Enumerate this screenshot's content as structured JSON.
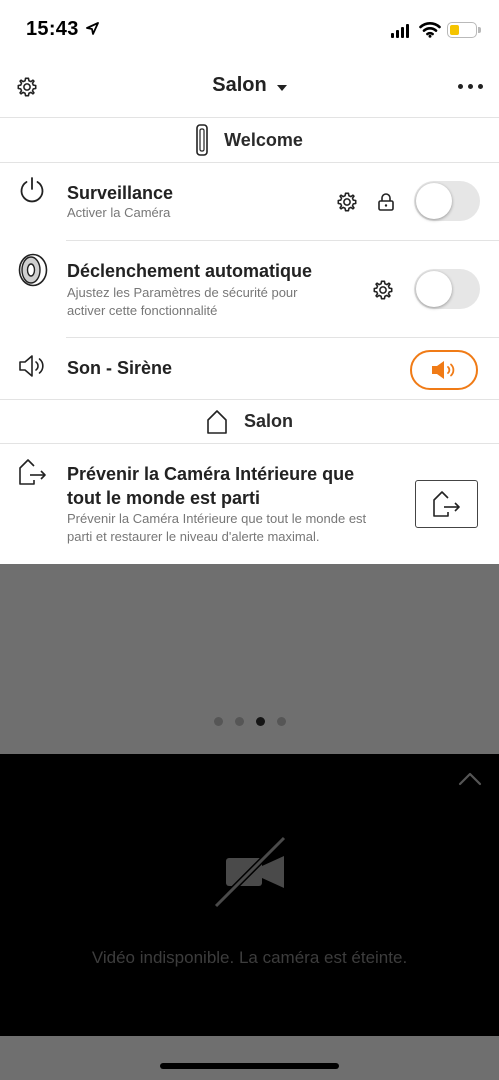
{
  "status_bar": {
    "time": "15:43"
  },
  "header": {
    "title": "Salon",
    "icons": [
      "gear-icon",
      "chevron-down-icon",
      "more-icon"
    ]
  },
  "camera_section": {
    "label": "Welcome",
    "icon": "camera-icon"
  },
  "surveillance": {
    "title": "Surveillance",
    "subtitle": "Activer la Caméra",
    "enabled": false,
    "icons": [
      "power-icon",
      "gear-icon",
      "lock-icon"
    ]
  },
  "auto_trigger": {
    "title": "Déclenchement automatique",
    "subtitle_line1": "Ajustez les Paramètres de sécurité pour",
    "subtitle_line2": "activer cette fonctionnalité",
    "enabled": false,
    "icons": [
      "siren-device-icon",
      "gear-icon"
    ]
  },
  "siren": {
    "title": "Son - Sirène",
    "icons": [
      "speaker-icon",
      "speaker-on-icon"
    ],
    "accent": "#f07b16"
  },
  "home_section": {
    "label": "Salon",
    "icon": "house-icon"
  },
  "leave": {
    "title_line1": "Prévenir la Caméra Intérieure que",
    "title_line2": "tout le monde est parti",
    "subtitle_line1": "Prévenir la Caméra Intérieure que tout le monde est",
    "subtitle_line2": "parti et restaurer le niveau d'alerte maximal.",
    "icons": [
      "leave-home-icon"
    ]
  },
  "pager": {
    "count": 4,
    "active_index": 2
  },
  "video": {
    "message": "Vidéo indisponible. La caméra est éteinte.",
    "icons": [
      "chevron-up-icon",
      "video-off-icon"
    ]
  }
}
